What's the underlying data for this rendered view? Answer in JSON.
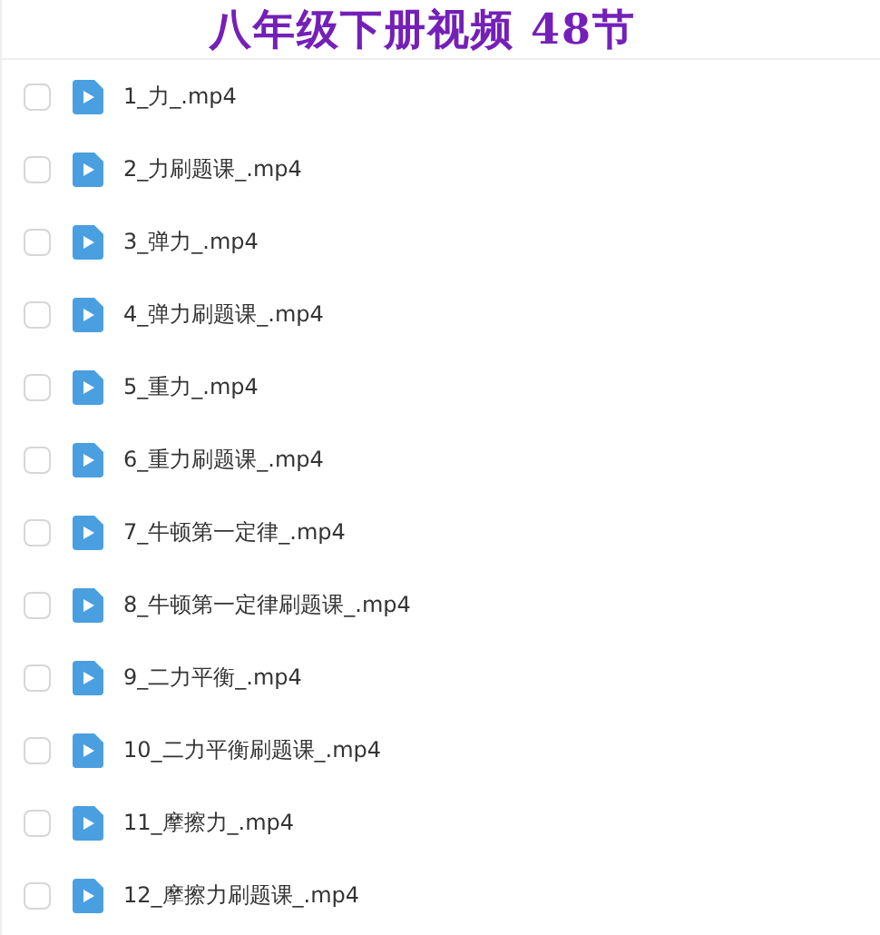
{
  "title": "八年级下册视频 48节",
  "files": [
    {
      "name": "1_力_.mp4",
      "checked": false
    },
    {
      "name": "2_力刷题课_.mp4",
      "checked": false
    },
    {
      "name": "3_弹力_.mp4",
      "checked": false
    },
    {
      "name": "4_弹力刷题课_.mp4",
      "checked": false
    },
    {
      "name": "5_重力_.mp4",
      "checked": false
    },
    {
      "name": "6_重力刷题课_.mp4",
      "checked": false
    },
    {
      "name": "7_牛顿第一定律_.mp4",
      "checked": false
    },
    {
      "name": "8_牛顿第一定律刷题课_.mp4",
      "checked": false
    },
    {
      "name": "9_二力平衡_.mp4",
      "checked": false
    },
    {
      "name": "10_二力平衡刷题课_.mp4",
      "checked": false
    },
    {
      "name": "11_摩擦力_.mp4",
      "checked": false
    },
    {
      "name": "12_摩擦力刷题课_.mp4",
      "checked": false
    }
  ]
}
